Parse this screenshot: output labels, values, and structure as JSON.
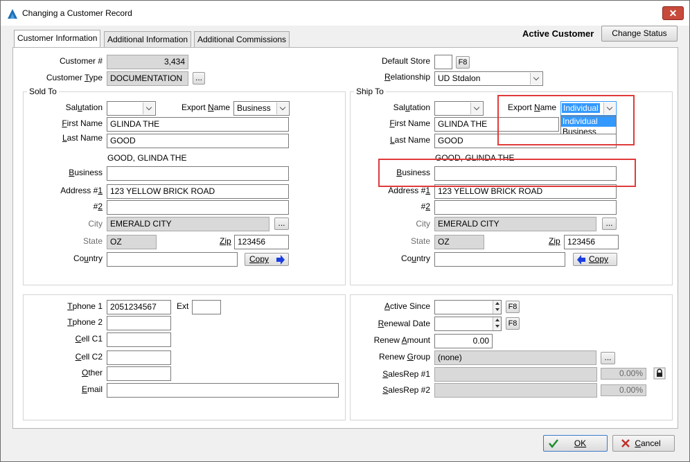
{
  "window": {
    "title": "Changing a Customer Record",
    "close_glyph": "✕"
  },
  "tabs": [
    "Customer Information",
    "Additional Information",
    "Additional Commissions"
  ],
  "header": {
    "status_label": "Active Customer",
    "change_status_button": "Change Status"
  },
  "top": {
    "customer_number_label": "Customer #",
    "customer_number": "3,434",
    "customer_type_label": "Customer Type",
    "customer_type": "DOCUMENTATION",
    "ellipsis": "...",
    "default_store_label": "Default Store",
    "default_store": "",
    "f8": "F8",
    "relationship_label": "Relationship",
    "relationship": "UD Stdalon"
  },
  "sold_to": {
    "title": "Sold To",
    "salutation_label": "Salutation",
    "salutation": "",
    "export_name_label": "Export Name",
    "export_name": "Business",
    "first_name_label": "First Name",
    "first_name": "GLINDA THE",
    "last_name_label": "Last Name",
    "last_name": "GOOD",
    "full_name": "GOOD, GLINDA THE",
    "business_label": "Business",
    "business": "",
    "address1_label": "Address #1",
    "address1": "123 YELLOW BRICK ROAD",
    "address2_label": "#2",
    "address2": "",
    "city_label": "City",
    "city": "EMERALD CITY",
    "state_label": "State",
    "state": "OZ",
    "zip_label": "Zip",
    "zip": "123456",
    "country_label": "Country",
    "country": "",
    "copy_button": "Copy"
  },
  "ship_to": {
    "title": "Ship To",
    "salutation_label": "Salutation",
    "salutation": "",
    "export_name_label": "Export Name",
    "export_name": "Individual",
    "export_name_options": [
      "Individual",
      "Business"
    ],
    "first_name_label": "First Name",
    "first_name": "GLINDA THE",
    "last_name_label": "Last Name",
    "last_name": "GOOD",
    "full_name": "GOOD, GLINDA THE",
    "business_label": "Business",
    "business": "",
    "address1_label": "Address #1",
    "address1": "123 YELLOW BRICK ROAD",
    "address2_label": "#2",
    "address2": "",
    "city_label": "City",
    "city": "EMERALD CITY",
    "state_label": "State",
    "state": "OZ",
    "zip_label": "Zip",
    "zip": "123456",
    "country_label": "Country",
    "country": "",
    "copy_button": "Copy"
  },
  "contact": {
    "tphone1_label": "Tphone 1",
    "tphone1": "2051234567",
    "ext_label": "Ext",
    "ext": "",
    "tphone2_label": "Tphone 2",
    "tphone2": "",
    "cell1_label": "Cell C1",
    "cell1": "",
    "cell2_label": "Cell C2",
    "cell2": "",
    "other_label": "Other",
    "other": "",
    "email_label": "Email",
    "email": ""
  },
  "account": {
    "active_since_label": "Active Since",
    "active_since": "",
    "renewal_date_label": "Renewal Date",
    "renewal_date": "",
    "renew_amount_label": "Renew Amount",
    "renew_amount": "0.00",
    "renew_group_label": "Renew Group",
    "renew_group": "(none)",
    "salesrep1_label": "SalesRep #1",
    "salesrep1": "",
    "salesrep1_pct": "0.00%",
    "salesrep2_label": "SalesRep #2",
    "salesrep2": "",
    "salesrep2_pct": "0.00%"
  },
  "footer": {
    "ok": "OK",
    "cancel": "Cancel"
  },
  "colors": {
    "highlight_box": "#e03a3a",
    "selection": "#3399ff",
    "close": "#c74a3a"
  }
}
